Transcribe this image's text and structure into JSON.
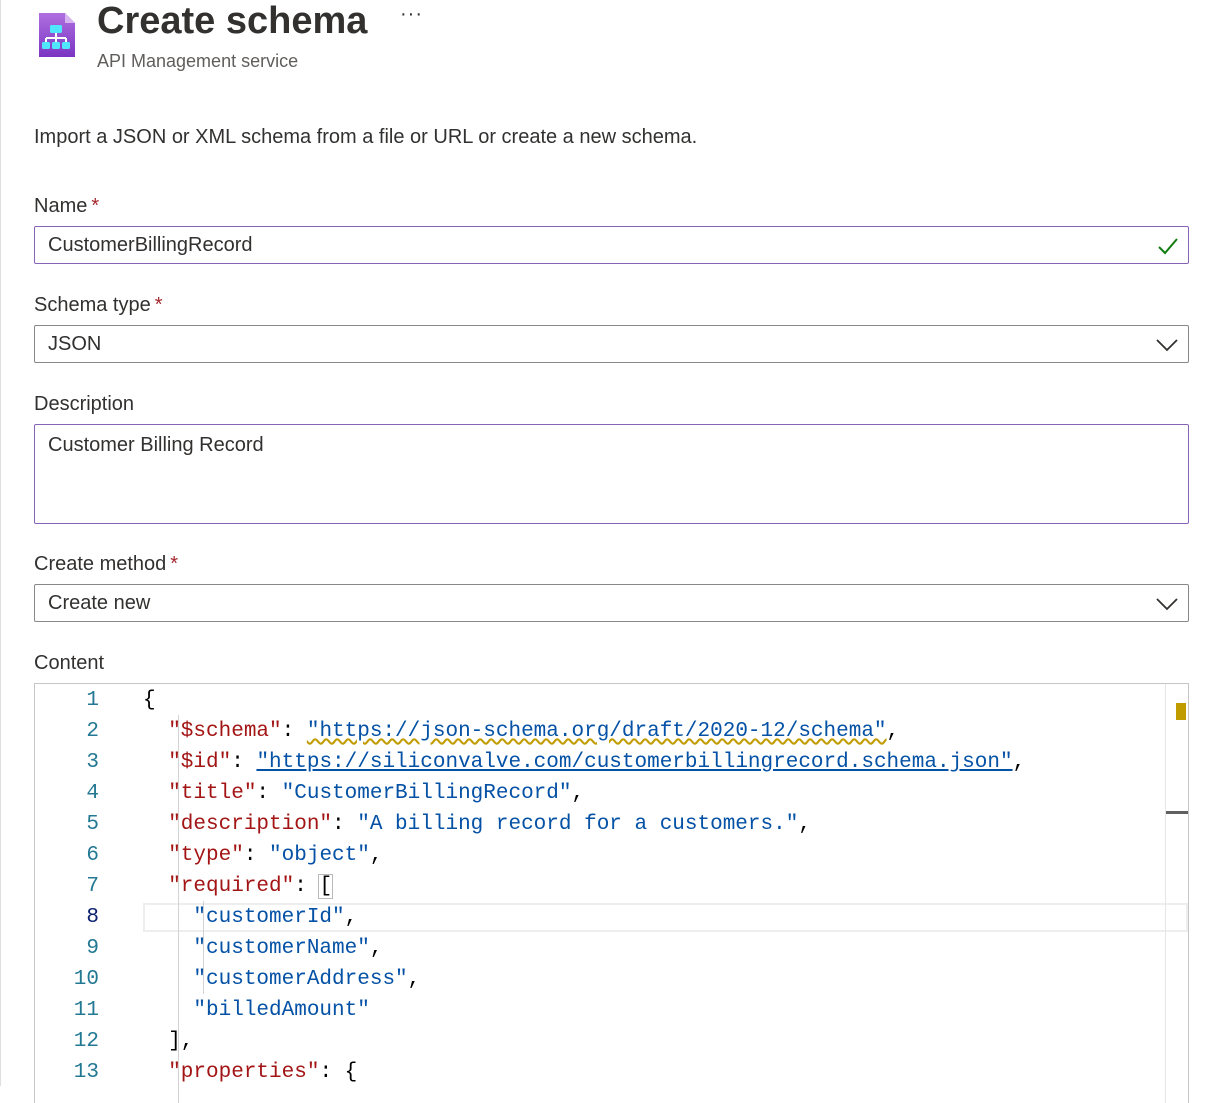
{
  "header": {
    "title": "Create schema",
    "subtitle": "API Management service",
    "more_label": "···"
  },
  "intro": "Import a JSON or XML schema from a file or URL or create a new schema.",
  "form": {
    "name": {
      "label": "Name",
      "required": "*",
      "value": "CustomerBillingRecord"
    },
    "schema_type": {
      "label": "Schema type",
      "required": "*",
      "value": "JSON"
    },
    "description": {
      "label": "Description",
      "value": "Customer Billing Record"
    },
    "create_method": {
      "label": "Create method",
      "required": "*",
      "value": "Create new"
    },
    "content": {
      "label": "Content"
    }
  },
  "editor": {
    "current_line": 8,
    "lines": [
      {
        "n": "1",
        "tokens": [
          [
            "p",
            "{"
          ]
        ]
      },
      {
        "n": "2",
        "tokens": [
          [
            "k",
            "  \"$schema\""
          ],
          [
            "p",
            ": "
          ],
          [
            "s",
            "\"https://json-schema.org/draft/2020-12/schema\""
          ],
          [
            "p",
            ","
          ]
        ]
      },
      {
        "n": "3",
        "tokens": [
          [
            "k",
            "  \"$id\""
          ],
          [
            "p",
            ": "
          ],
          [
            "s",
            "\"https://siliconvalve.com/customerbillingrecord.schema.json\""
          ],
          [
            "p",
            ","
          ]
        ]
      },
      {
        "n": "4",
        "tokens": [
          [
            "k",
            "  \"title\""
          ],
          [
            "p",
            ": "
          ],
          [
            "s",
            "\"CustomerBillingRecord\""
          ],
          [
            "p",
            ","
          ]
        ]
      },
      {
        "n": "5",
        "tokens": [
          [
            "k",
            "  \"description\""
          ],
          [
            "p",
            ": "
          ],
          [
            "s",
            "\"A billing record for a customers.\""
          ],
          [
            "p",
            ","
          ]
        ]
      },
      {
        "n": "6",
        "tokens": [
          [
            "k",
            "  \"type\""
          ],
          [
            "p",
            ": "
          ],
          [
            "s",
            "\"object\""
          ],
          [
            "p",
            ","
          ]
        ]
      },
      {
        "n": "7",
        "tokens": [
          [
            "k",
            "  \"required\""
          ],
          [
            "p",
            ": "
          ],
          [
            "p",
            "["
          ]
        ]
      },
      {
        "n": "8",
        "tokens": [
          [
            "s",
            "    \"customerId\""
          ],
          [
            "p",
            ","
          ]
        ]
      },
      {
        "n": "9",
        "tokens": [
          [
            "s",
            "    \"customerName\""
          ],
          [
            "p",
            ","
          ]
        ]
      },
      {
        "n": "10",
        "tokens": [
          [
            "s",
            "    \"customerAddress\""
          ],
          [
            "p",
            ","
          ]
        ]
      },
      {
        "n": "11",
        "tokens": [
          [
            "s",
            "    \"billedAmount\""
          ]
        ]
      },
      {
        "n": "12",
        "tokens": [
          [
            "p",
            "  ],"
          ]
        ]
      },
      {
        "n": "13",
        "tokens": [
          [
            "k",
            "  \"properties\""
          ],
          [
            "p",
            ": "
          ],
          [
            "p",
            "{"
          ]
        ]
      }
    ]
  },
  "colors": {
    "accent_border": "#8764b8",
    "success": "#107c10",
    "required": "#a4262c",
    "json_key": "#a31515",
    "json_string": "#0451a5",
    "line_number": "#237893"
  },
  "icons": [
    "api-management-icon",
    "more-icon",
    "checkmark-icon",
    "chevron-down-icon"
  ]
}
